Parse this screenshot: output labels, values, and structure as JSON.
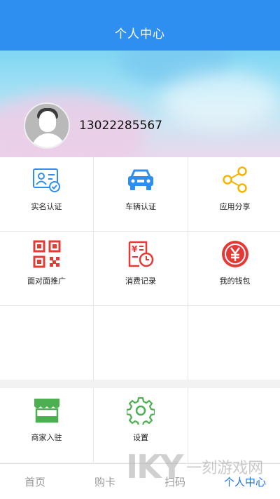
{
  "header": {
    "title": "个人中心"
  },
  "profile": {
    "phone": "13022285567"
  },
  "menu": [
    {
      "label": "实名认证",
      "icon": "id-card-icon",
      "color": "#2f8ff0"
    },
    {
      "label": "车辆认证",
      "icon": "car-icon",
      "color": "#2f8ff0"
    },
    {
      "label": "应用分享",
      "icon": "share-icon",
      "color": "#f5b400"
    },
    {
      "label": "面对面推广",
      "icon": "qr-code-icon",
      "color": "#e53935"
    },
    {
      "label": "消费记录",
      "icon": "receipt-clock-icon",
      "color": "#e53935"
    },
    {
      "label": "我的钱包",
      "icon": "yuan-wallet-icon",
      "color": "#e53935"
    }
  ],
  "menu2": [
    {
      "label": "商家入驻",
      "icon": "store-icon",
      "color": "#4caf50"
    },
    {
      "label": "设置",
      "icon": "gear-icon",
      "color": "#4caf50"
    }
  ],
  "tabs": [
    {
      "label": "首页",
      "active": false
    },
    {
      "label": "购卡",
      "active": false
    },
    {
      "label": "扫码",
      "active": false
    },
    {
      "label": "个人中心",
      "active": true
    }
  ],
  "colors": {
    "primary": "#2f8ff0",
    "active_tab": "#1a73e8"
  },
  "watermark": {
    "logo": "IKY",
    "text": "一刻游戏网"
  }
}
